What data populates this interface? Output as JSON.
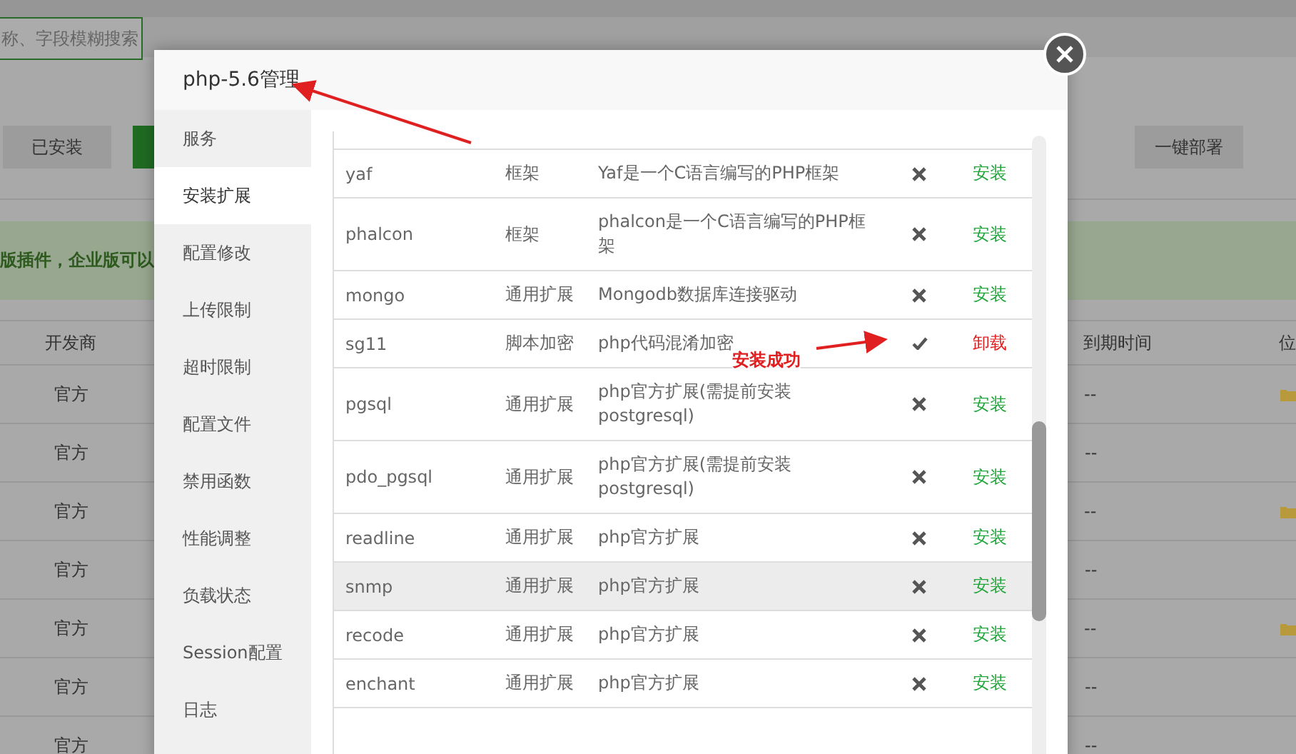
{
  "background": {
    "search": {
      "placeholder": "称、字段模糊搜索"
    },
    "buttons": [
      {
        "label": "已安装",
        "kind": "plain"
      },
      {
        "kind": "primary"
      },
      {
        "label": "一键部署",
        "kind": "plain"
      }
    ],
    "notice": "版插件，企业版可以",
    "table": {
      "columns": [
        "开发商",
        "到期时间",
        "位"
      ],
      "rows": [
        {
          "developer": "官方",
          "expiry": "--",
          "folder": true
        },
        {
          "developer": "官方",
          "expiry": "--",
          "folder": false
        },
        {
          "developer": "官方",
          "expiry": "--",
          "folder": true
        },
        {
          "developer": "官方",
          "expiry": "--",
          "folder": false
        },
        {
          "developer": "官方",
          "expiry": "--",
          "folder": true
        },
        {
          "developer": "官方",
          "expiry": "--",
          "folder": false
        },
        {
          "developer": "官方",
          "expiry": "--",
          "folder": false
        }
      ]
    }
  },
  "dialog": {
    "title": "php-5.6管理",
    "sidebar": [
      {
        "label": "服务",
        "selected": false
      },
      {
        "label": "安装扩展",
        "selected": true
      },
      {
        "label": "配置修改",
        "selected": false
      },
      {
        "label": "上传限制",
        "selected": false
      },
      {
        "label": "超时限制",
        "selected": false
      },
      {
        "label": "配置文件",
        "selected": false
      },
      {
        "label": "禁用函数",
        "selected": false
      },
      {
        "label": "性能调整",
        "selected": false
      },
      {
        "label": "负载状态",
        "selected": false
      },
      {
        "label": "Session配置",
        "selected": false
      },
      {
        "label": "日志",
        "selected": false
      }
    ],
    "extensions": [
      {
        "name": "yaf",
        "type": "框架",
        "description": "Yaf是一个C语言编写的PHP框架",
        "installed": false,
        "action": "安装",
        "hovered": false
      },
      {
        "name": "phalcon",
        "type": "框架",
        "description": "phalcon是一个C语言编写的PHP框架",
        "installed": false,
        "action": "安装",
        "hovered": false
      },
      {
        "name": "mongo",
        "type": "通用扩展",
        "description": "Mongodb数据库连接驱动",
        "installed": false,
        "action": "安装",
        "hovered": false
      },
      {
        "name": "sg11",
        "type": "脚本加密",
        "description": "php代码混淆加密",
        "installed": true,
        "action": "卸载",
        "hovered": false
      },
      {
        "name": "pgsql",
        "type": "通用扩展",
        "description": "php官方扩展(需提前安装postgresql)",
        "installed": false,
        "action": "安装",
        "hovered": false
      },
      {
        "name": "pdo_pgsql",
        "type": "通用扩展",
        "description": "php官方扩展(需提前安装postgresql)",
        "installed": false,
        "action": "安装",
        "hovered": false
      },
      {
        "name": "readline",
        "type": "通用扩展",
        "description": "php官方扩展",
        "installed": false,
        "action": "安装",
        "hovered": false
      },
      {
        "name": "snmp",
        "type": "通用扩展",
        "description": "php官方扩展",
        "installed": false,
        "action": "安装",
        "hovered": true
      },
      {
        "name": "recode",
        "type": "通用扩展",
        "description": "php官方扩展",
        "installed": false,
        "action": "安装",
        "hovered": false
      },
      {
        "name": "enchant",
        "type": "通用扩展",
        "description": "php官方扩展",
        "installed": false,
        "action": "安装",
        "hovered": false
      }
    ]
  },
  "annotation": {
    "label": "安装成功"
  }
}
